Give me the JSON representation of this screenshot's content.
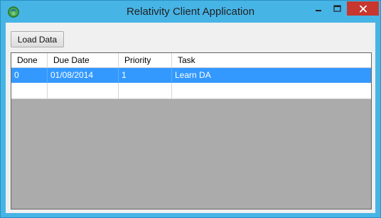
{
  "window": {
    "title": "Relativity Client Application",
    "accent_color": "#47b4e6",
    "close_color": "#c7372f"
  },
  "toolbar": {
    "load_label": "Load Data"
  },
  "grid": {
    "columns": [
      "Done",
      "Due Date",
      "Priority",
      "Task"
    ],
    "rows": [
      {
        "done": "0",
        "due_date": "01/08/2014",
        "priority": "1",
        "task": "Learn DA",
        "selected": true
      },
      {
        "done": "",
        "due_date": "",
        "priority": "",
        "task": "",
        "selected": false
      }
    ],
    "selection_color": "#3399ff",
    "empty_area_color": "#ababab"
  }
}
